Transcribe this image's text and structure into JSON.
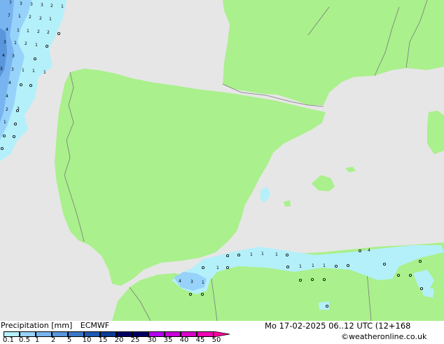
{
  "legend": {
    "title": "Precipitation [mm]",
    "model": "ECMWF",
    "ticks": [
      "0.1",
      "0.5",
      "1",
      "2",
      "5",
      "10",
      "15",
      "20",
      "25",
      "30",
      "35",
      "40",
      "45",
      "50"
    ],
    "colors": [
      "#b4f0fa",
      "#96d2fa",
      "#78b4f0",
      "#5a96dc",
      "#3c78c8",
      "#1e5ab4",
      "#0a3c96",
      "#000064",
      "#b400f0",
      "#c800dc",
      "#dc00c8",
      "#f000b4",
      "#ff00a0"
    ]
  },
  "valid_time": "Mo 17-02-2025 06..12 UTC (12+168",
  "credit": "©weatheronline.co.uk",
  "map_colors": {
    "sea": "#e6e6e6",
    "land": "#aaf08c",
    "border": "#7a7a7a"
  },
  "point_labels": [
    "7",
    "3",
    "3",
    "3",
    "2",
    "1",
    "7",
    "1",
    "2",
    "2",
    "1",
    "4",
    "1",
    "1",
    "2",
    "2",
    "3",
    "1",
    "2",
    "1",
    "4",
    "3",
    "3",
    "1",
    "4",
    "2",
    "1",
    "4",
    "3",
    "1",
    "4",
    "3",
    "1",
    "1",
    "1",
    "1",
    "1",
    "1",
    "1",
    "1",
    "4",
    "3",
    "1"
  ]
}
